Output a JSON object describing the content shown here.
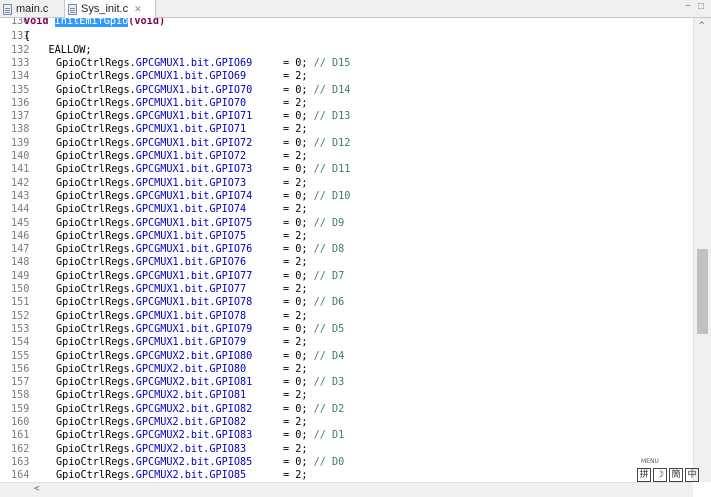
{
  "tabs": [
    {
      "label": "main.c",
      "active": false
    },
    {
      "label": "Sys_init.c",
      "active": true,
      "close": "✕"
    }
  ],
  "window_controls": {
    "minimize": "−",
    "maximize": "□"
  },
  "function_header": {
    "lnum": "130",
    "text": "void ",
    "name": "InitEmifGpio",
    "rest": "(void)"
  },
  "lines": [
    {
      "n": "131",
      "t": "{"
    },
    {
      "n": "132",
      "t": "    EALLOW;"
    },
    {
      "n": "133",
      "obj": "GpioCtrlRegs.",
      "fld": "GPCGMUX1.bit.GPIO69",
      "asg": "     = 0; ",
      "cmt": "// D15"
    },
    {
      "n": "134",
      "obj": "GpioCtrlRegs.",
      "fld": "GPCMUX1.bit.GPIO69",
      "asg": "      = 2;",
      "cmt": ""
    },
    {
      "n": "135",
      "obj": "GpioCtrlRegs.",
      "fld": "GPCGMUX1.bit.GPIO70",
      "asg": "     = 0; ",
      "cmt": "// D14"
    },
    {
      "n": "136",
      "obj": "GpioCtrlRegs.",
      "fld": "GPCMUX1.bit.GPIO70",
      "asg": "      = 2;",
      "cmt": ""
    },
    {
      "n": "137",
      "obj": "GpioCtrlRegs.",
      "fld": "GPCGMUX1.bit.GPIO71",
      "asg": "     = 0; ",
      "cmt": "// D13"
    },
    {
      "n": "138",
      "obj": "GpioCtrlRegs.",
      "fld": "GPCMUX1.bit.GPIO71",
      "asg": "      = 2;",
      "cmt": ""
    },
    {
      "n": "139",
      "obj": "GpioCtrlRegs.",
      "fld": "GPCGMUX1.bit.GPIO72",
      "asg": "     = 0; ",
      "cmt": "// D12"
    },
    {
      "n": "140",
      "obj": "GpioCtrlRegs.",
      "fld": "GPCMUX1.bit.GPIO72",
      "asg": "      = 2;",
      "cmt": ""
    },
    {
      "n": "141",
      "obj": "GpioCtrlRegs.",
      "fld": "GPCGMUX1.bit.GPIO73",
      "asg": "     = 0; ",
      "cmt": "// D11"
    },
    {
      "n": "142",
      "obj": "GpioCtrlRegs.",
      "fld": "GPCMUX1.bit.GPIO73",
      "asg": "      = 2;",
      "cmt": ""
    },
    {
      "n": "143",
      "obj": "GpioCtrlRegs.",
      "fld": "GPCGMUX1.bit.GPIO74",
      "asg": "     = 0; ",
      "cmt": "// D10"
    },
    {
      "n": "144",
      "obj": "GpioCtrlRegs.",
      "fld": "GPCMUX1.bit.GPIO74",
      "asg": "      = 2;",
      "cmt": ""
    },
    {
      "n": "145",
      "obj": "GpioCtrlRegs.",
      "fld": "GPCGMUX1.bit.GPIO75",
      "asg": "     = 0; ",
      "cmt": "// D9"
    },
    {
      "n": "146",
      "obj": "GpioCtrlRegs.",
      "fld": "GPCMUX1.bit.GPIO75",
      "asg": "      = 2;",
      "cmt": ""
    },
    {
      "n": "147",
      "obj": "GpioCtrlRegs.",
      "fld": "GPCGMUX1.bit.GPIO76",
      "asg": "     = 0; ",
      "cmt": "// D8"
    },
    {
      "n": "148",
      "obj": "GpioCtrlRegs.",
      "fld": "GPCMUX1.bit.GPIO76",
      "asg": "      = 2;",
      "cmt": ""
    },
    {
      "n": "149",
      "obj": "GpioCtrlRegs.",
      "fld": "GPCGMUX1.bit.GPIO77",
      "asg": "     = 0; ",
      "cmt": "// D7"
    },
    {
      "n": "150",
      "obj": "GpioCtrlRegs.",
      "fld": "GPCMUX1.bit.GPIO77",
      "asg": "      = 2;",
      "cmt": ""
    },
    {
      "n": "151",
      "obj": "GpioCtrlRegs.",
      "fld": "GPCGMUX1.bit.GPIO78",
      "asg": "     = 0; ",
      "cmt": "// D6"
    },
    {
      "n": "152",
      "obj": "GpioCtrlRegs.",
      "fld": "GPCMUX1.bit.GPIO78",
      "asg": "      = 2;",
      "cmt": ""
    },
    {
      "n": "153",
      "obj": "GpioCtrlRegs.",
      "fld": "GPCGMUX1.bit.GPIO79",
      "asg": "     = 0; ",
      "cmt": "// D5"
    },
    {
      "n": "154",
      "obj": "GpioCtrlRegs.",
      "fld": "GPCMUX1.bit.GPIO79",
      "asg": "      = 2;",
      "cmt": ""
    },
    {
      "n": "155",
      "obj": "GpioCtrlRegs.",
      "fld": "GPCGMUX2.bit.GPIO80",
      "asg": "     = 0; ",
      "cmt": "// D4"
    },
    {
      "n": "156",
      "obj": "GpioCtrlRegs.",
      "fld": "GPCMUX2.bit.GPIO80",
      "asg": "      = 2;",
      "cmt": ""
    },
    {
      "n": "157",
      "obj": "GpioCtrlRegs.",
      "fld": "GPCGMUX2.bit.GPIO81",
      "asg": "     = 0; ",
      "cmt": "// D3"
    },
    {
      "n": "158",
      "obj": "GpioCtrlRegs.",
      "fld": "GPCMUX2.bit.GPIO81",
      "asg": "      = 2;",
      "cmt": ""
    },
    {
      "n": "159",
      "obj": "GpioCtrlRegs.",
      "fld": "GPCGMUX2.bit.GPIO82",
      "asg": "     = 0; ",
      "cmt": "// D2"
    },
    {
      "n": "160",
      "obj": "GpioCtrlRegs.",
      "fld": "GPCMUX2.bit.GPIO82",
      "asg": "      = 2;",
      "cmt": ""
    },
    {
      "n": "161",
      "obj": "GpioCtrlRegs.",
      "fld": "GPCGMUX2.bit.GPIO83",
      "asg": "     = 0; ",
      "cmt": "// D1"
    },
    {
      "n": "162",
      "obj": "GpioCtrlRegs.",
      "fld": "GPCMUX2.bit.GPIO83",
      "asg": "      = 2;",
      "cmt": ""
    },
    {
      "n": "163",
      "obj": "GpioCtrlRegs.",
      "fld": "GPCGMUX2.bit.GPIO85",
      "asg": "     = 0; ",
      "cmt": "// D0"
    },
    {
      "n": "164",
      "obj": "GpioCtrlRegs.",
      "fld": "GPCMUX2.bit.GPIO85",
      "asg": "      = 2;",
      "cmt": ""
    }
  ],
  "scroll_position": 0.62,
  "ime": {
    "top_label": "MENU",
    "items": [
      "拼",
      "☽",
      "簡",
      "中"
    ]
  },
  "colors": {
    "field": "#0000c0",
    "comment": "#3f7f5f",
    "keyword": "#7f0055",
    "line_number": "#7a7a7a",
    "selection": "#3399ff"
  }
}
